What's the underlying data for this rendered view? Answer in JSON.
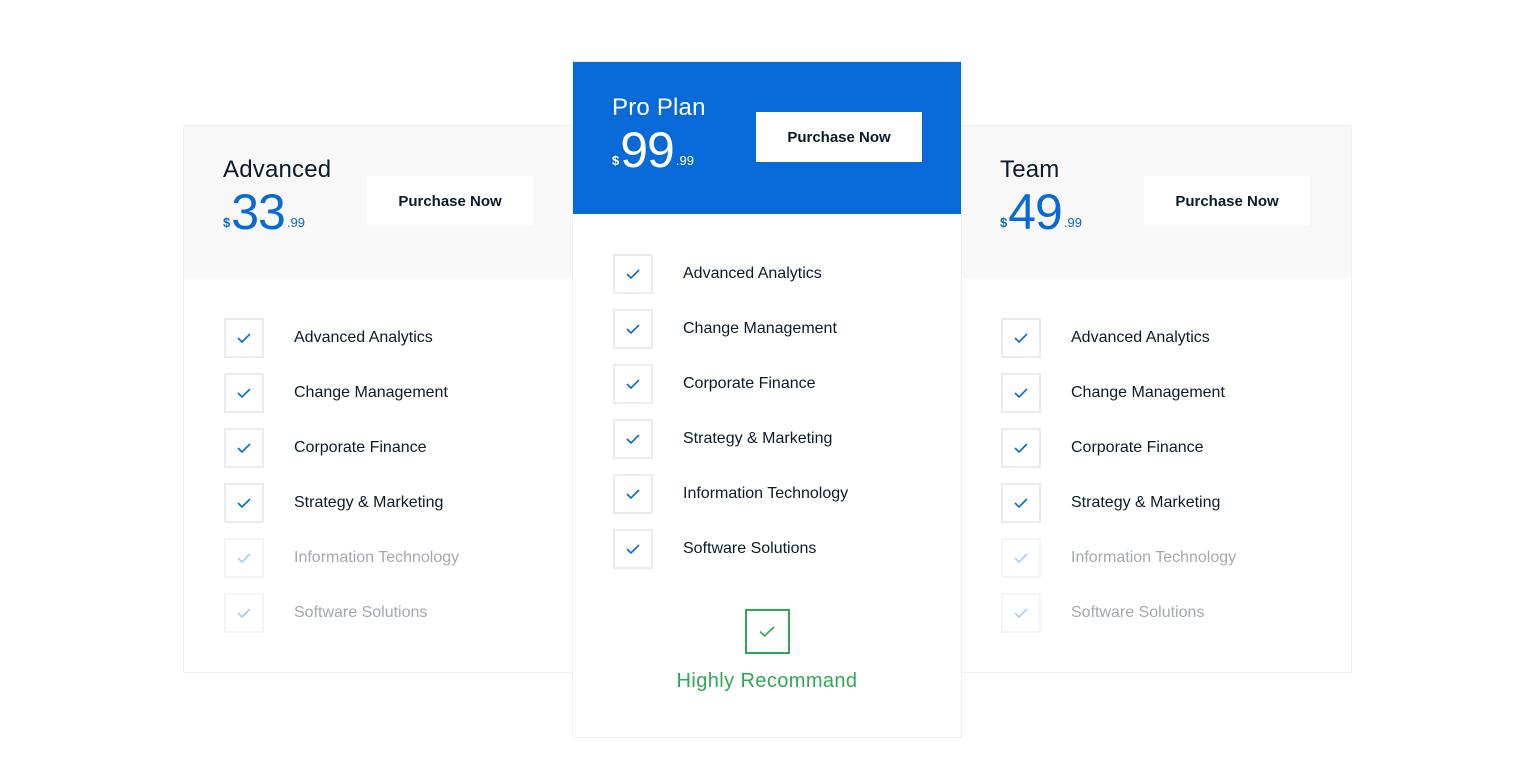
{
  "colors": {
    "accent": "#086ad8",
    "recommend": "#30a853",
    "text": "#0c1a2b",
    "muted": "#a4a9af"
  },
  "plans": [
    {
      "name": "Advanced",
      "currency": "$",
      "amount": "33",
      "cents": ".99",
      "button": "Purchase Now",
      "features": [
        {
          "label": "Advanced Analytics",
          "included": true
        },
        {
          "label": "Change Management",
          "included": true
        },
        {
          "label": "Corporate Finance",
          "included": true
        },
        {
          "label": "Strategy & Marketing",
          "included": true
        },
        {
          "label": "Information Technology",
          "included": false
        },
        {
          "label": "Software Solutions",
          "included": false
        }
      ]
    },
    {
      "name": "Pro Plan",
      "currency": "$",
      "amount": "99",
      "cents": ".99",
      "button": "Purchase Now",
      "features": [
        {
          "label": "Advanced Analytics",
          "included": true
        },
        {
          "label": "Change Management",
          "included": true
        },
        {
          "label": "Corporate Finance",
          "included": true
        },
        {
          "label": "Strategy & Marketing",
          "included": true
        },
        {
          "label": "Information Technology",
          "included": true
        },
        {
          "label": "Software Solutions",
          "included": true
        }
      ],
      "recommend_label": "Highly Recommand",
      "recommend_icon": "check-icon"
    },
    {
      "name": "Team",
      "currency": "$",
      "amount": "49",
      "cents": ".99",
      "button": "Purchase Now",
      "features": [
        {
          "label": "Advanced Analytics",
          "included": true
        },
        {
          "label": "Change Management",
          "included": true
        },
        {
          "label": "Corporate Finance",
          "included": true
        },
        {
          "label": "Strategy & Marketing",
          "included": true
        },
        {
          "label": "Information Technology",
          "included": false
        },
        {
          "label": "Software Solutions",
          "included": false
        }
      ]
    }
  ]
}
